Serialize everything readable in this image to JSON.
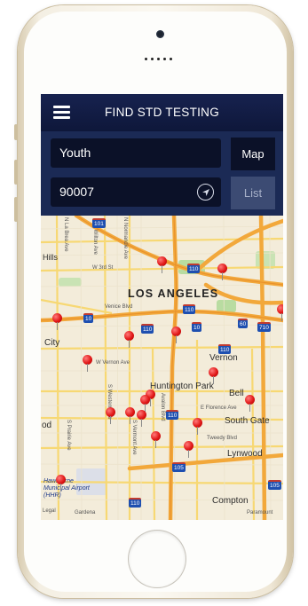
{
  "app": {
    "title": "FIND STD TESTING",
    "menu_icon": "hamburger-menu-icon"
  },
  "search": {
    "keyword_value": "Youth",
    "zip_value": "90007",
    "locate_icon": "location-arrow-icon"
  },
  "view_tabs": {
    "map_label": "Map",
    "list_label": "List",
    "selected": "Map"
  },
  "map": {
    "labels": {
      "city": "LOS ANGELES",
      "hills": "Hills",
      "city_left": "City",
      "huntington_park": "Huntington Park",
      "bell": "Bell",
      "vernon": "Vernon",
      "south_gate": "South Gate",
      "lynwood": "Lynwood",
      "compton": "Compton",
      "wood": "od",
      "airport": "Hawthorne Municipal Airport (HHR)",
      "w3rd": "W 3rd St",
      "venice": "Venice Blvd",
      "wvernon": "W Vernon Ave",
      "florence": "E Florence Ave",
      "tweedy": "Tweedy Blvd",
      "western": "S Western Ave",
      "vermont": "S Vermont Ave",
      "avalon": "Avalon Blvd",
      "prairie": "S Prairie Ave",
      "laurel": "N La Brea Ave",
      "normandie": "N Normandie Ave",
      "bristol": "S Wilton Ave",
      "gardena": "Gardena",
      "paramount": "Paramount",
      "legal": "Legal"
    },
    "highways": [
      "101",
      "110",
      "10",
      "10",
      "110",
      "110",
      "60",
      "710",
      "110",
      "105",
      "110",
      "105",
      "110"
    ]
  },
  "colors": {
    "header_bg": "#0e173a",
    "panel_bg": "#1b2a55",
    "field_bg": "#0b1128",
    "pin_red": "#e11818",
    "freeway_orange": "#f2a83b",
    "street_yellow": "#f7d873",
    "park_green": "#b9dca1"
  }
}
